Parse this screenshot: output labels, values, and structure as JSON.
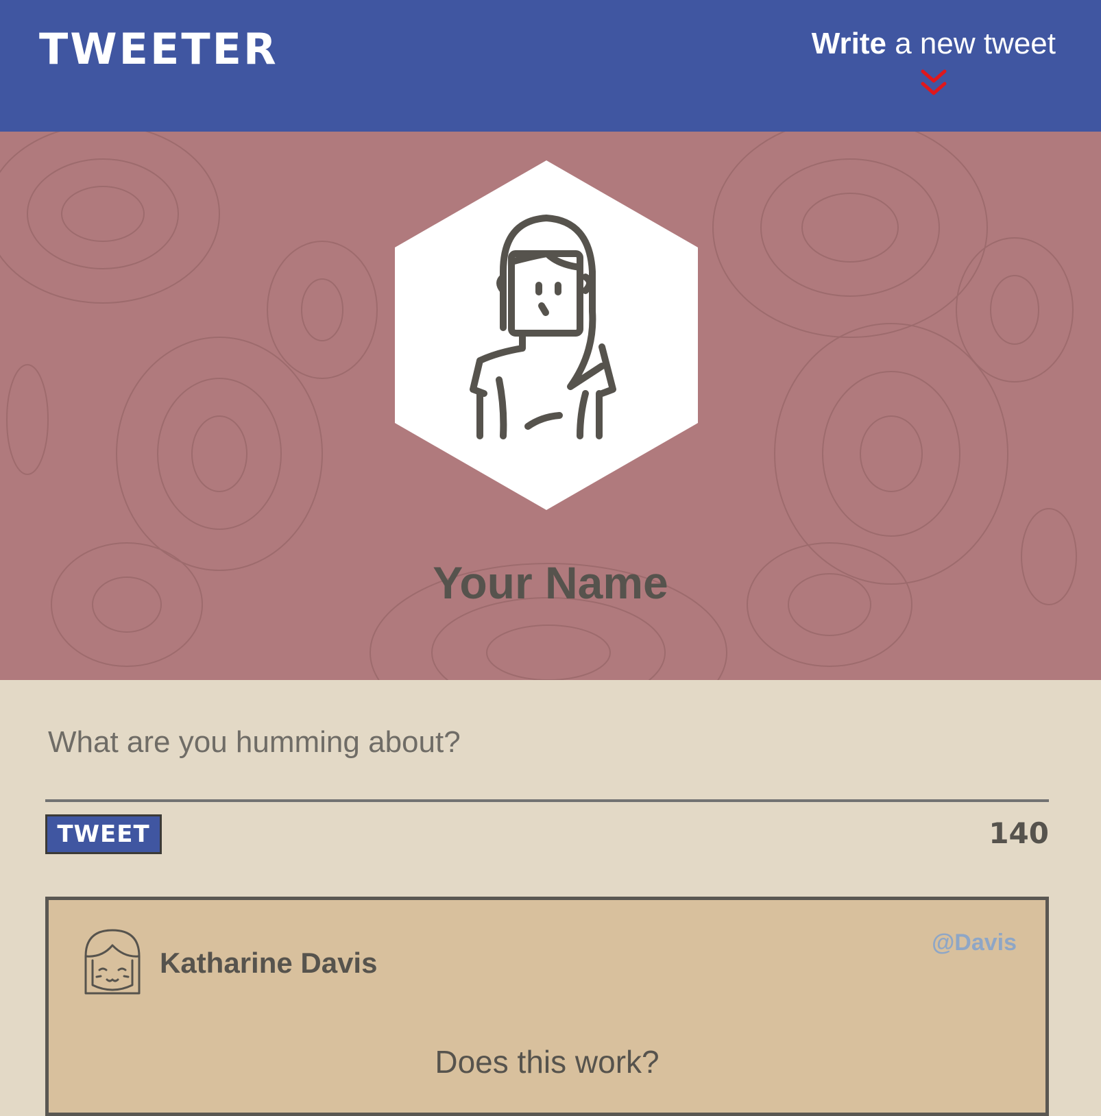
{
  "header": {
    "brand": "TWEETER",
    "write_link": {
      "strong": "Write",
      "rest": " a new tweet",
      "icon": "double-chevron-down-icon"
    }
  },
  "profile": {
    "avatar_icon": "user-female-avatar-icon",
    "name": "Your Name"
  },
  "compose": {
    "placeholder": "What are you humming about?",
    "value": "",
    "button_label": "TWEET",
    "char_count": "140"
  },
  "tweets": [
    {
      "avatar_icon": "smiling-girl-avatar-icon",
      "name": "Katharine Davis",
      "handle": "@Davis",
      "text": "Does this work?"
    }
  ],
  "colors": {
    "nav": "#4056a1",
    "hero": "#b07a7d",
    "page": "#e3d9c6",
    "card": "#d8c09d",
    "text": "#56534d",
    "handle": "#8ea6c6",
    "chevron": "#e0171c"
  }
}
